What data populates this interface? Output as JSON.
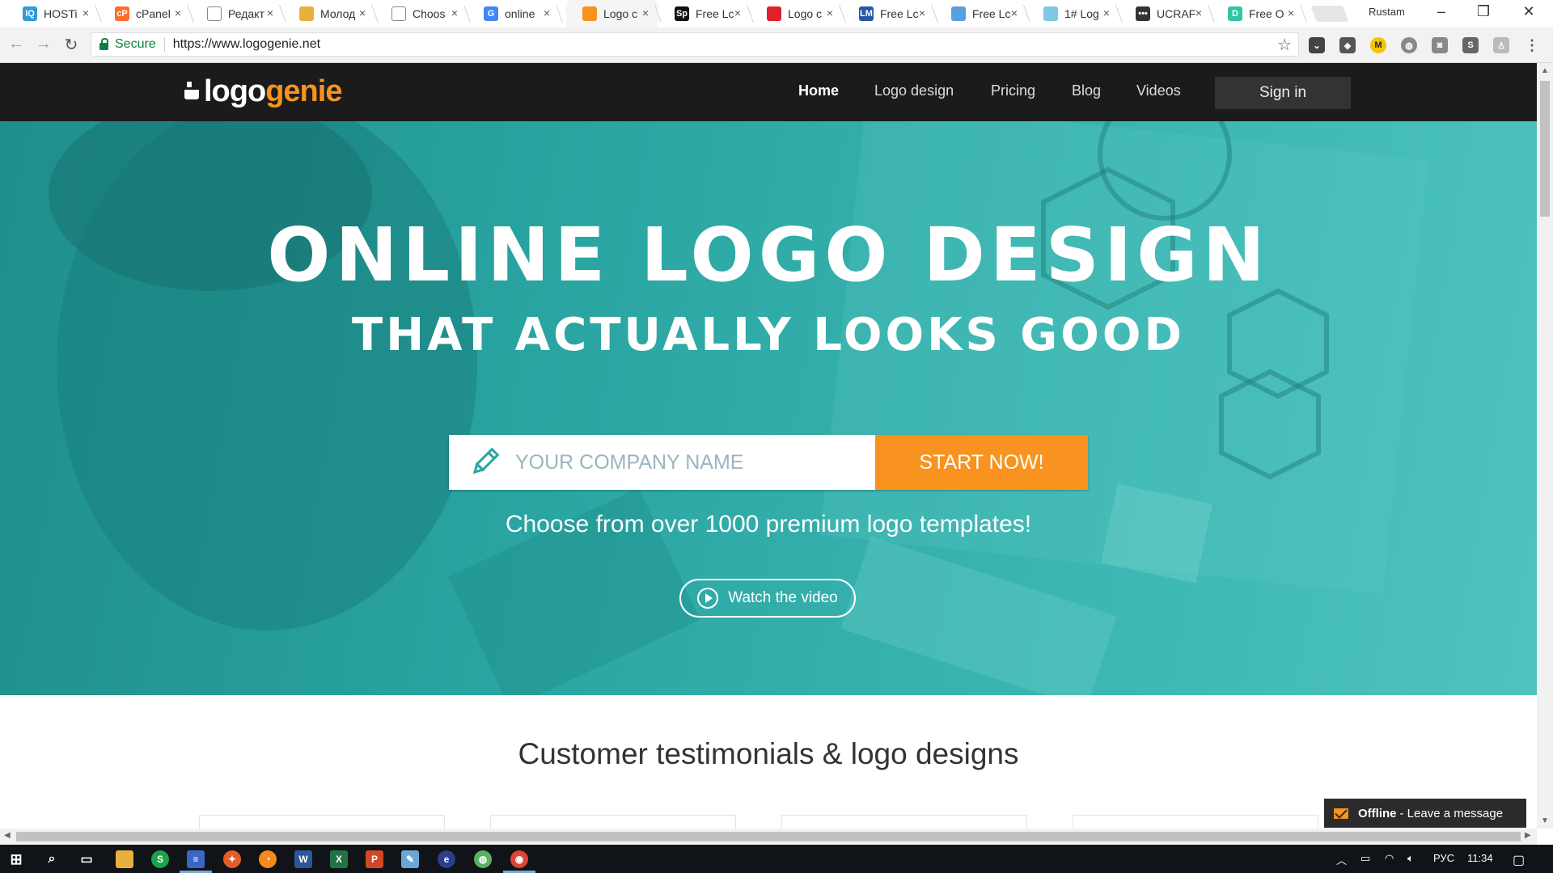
{
  "browser": {
    "tabs": [
      {
        "title": "HOSTi",
        "fav_text": "IQ",
        "fav_color": "#2d9cdb"
      },
      {
        "title": "cPanel",
        "fav_text": "cP",
        "fav_color": "#ff6c2c"
      },
      {
        "title": "Редакт",
        "fav_text": "",
        "fav_color": "#ffffff"
      },
      {
        "title": "Молод",
        "fav_text": "",
        "fav_color": "#e8b13b"
      },
      {
        "title": "Choos",
        "fav_text": "",
        "fav_color": "#ffffff"
      },
      {
        "title": "online",
        "fav_text": "G",
        "fav_color": "#4285f4"
      },
      {
        "title": "Logo c",
        "fav_text": "",
        "fav_color": "#f7931e"
      },
      {
        "title": "Free Lc",
        "fav_text": "Sp",
        "fav_color": "#111111"
      },
      {
        "title": "Logo c",
        "fav_text": "",
        "fav_color": "#e0202d"
      },
      {
        "title": "Free Lc",
        "fav_text": "LM",
        "fav_color": "#2458a6"
      },
      {
        "title": "Free Lc",
        "fav_text": "",
        "fav_color": "#5aa0e0"
      },
      {
        "title": "1# Log",
        "fav_text": "",
        "fav_color": "#7ec8e3"
      },
      {
        "title": "UCRAF",
        "fav_text": "•••",
        "fav_color": "#333333"
      },
      {
        "title": "Free O",
        "fav_text": "D",
        "fav_color": "#34c3a7"
      }
    ],
    "profile_name": "Rustam",
    "secure_label": "Secure",
    "url": "https://www.logogenie.net"
  },
  "site": {
    "logo_part1": "logo",
    "logo_part2": "genie",
    "nav": {
      "home": "Home",
      "logo_design": "Logo design",
      "pricing": "Pricing",
      "blog": "Blog",
      "videos": "Videos",
      "sign_in": "Sign in"
    },
    "hero": {
      "headline": "ONLINE LOGO DESIGN",
      "subheadline": "THAT ACTUALLY LOOKS GOOD",
      "input_placeholder": "YOUR COMPANY NAME",
      "input_value": "",
      "cta": "START NOW!",
      "tagline": "Choose from over 1000 premium logo templates!",
      "watch_video": "Watch the video"
    },
    "testimonials_title": "Customer testimonials & logo designs",
    "chat": {
      "status": "Offline",
      "message": "- Leave a message"
    }
  },
  "taskbar": {
    "language": "РУС",
    "time": "11:34"
  },
  "colors": {
    "accent_orange": "#f7931e",
    "hero_teal": "#2ba6a3",
    "nav_dark": "#1b1b1b"
  },
  "icons": [
    "pencil-icon",
    "play-icon",
    "star-icon",
    "lock-icon",
    "mail-icon",
    "windows-start-icon",
    "search-icon"
  ]
}
